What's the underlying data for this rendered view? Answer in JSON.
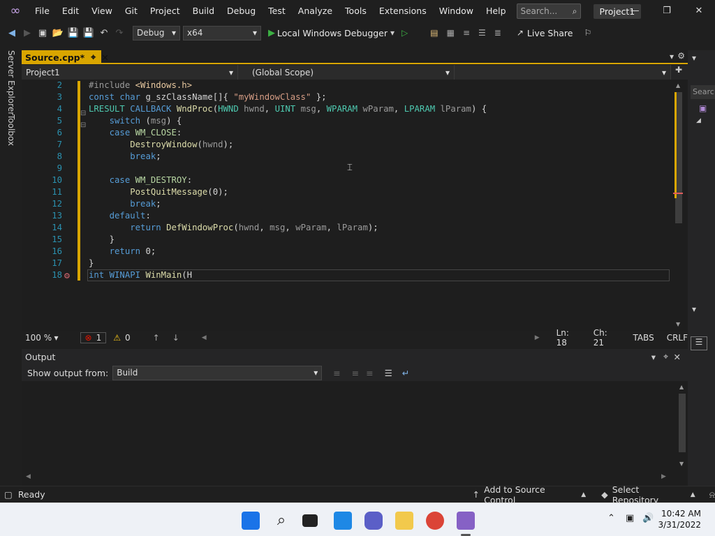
{
  "menu": [
    "File",
    "Edit",
    "View",
    "Git",
    "Project",
    "Build",
    "Debug",
    "Test",
    "Analyze",
    "Tools",
    "Extensions",
    "Window",
    "Help"
  ],
  "search_placeholder": "Search...",
  "project_badge": "Project1",
  "toolbar": {
    "config": "Debug",
    "platform": "x64",
    "debugger": "Local Windows Debugger",
    "live_share": "Live Share"
  },
  "left_tabs": [
    "Server Explorer",
    "Toolbox"
  ],
  "doc_tab": "Source.cpp*",
  "nav": {
    "project": "Project1",
    "scope": "(Global Scope)",
    "member": ""
  },
  "line_numbers": [
    "2",
    "3",
    "4",
    "5",
    "6",
    "7",
    "8",
    "9",
    "10",
    "11",
    "12",
    "13",
    "14",
    "15",
    "16",
    "17",
    "18"
  ],
  "code_lines": [
    [
      [
        "p",
        "#include "
      ],
      [
        "incf",
        "<Windows.h>"
      ]
    ],
    [
      [
        "k",
        "const "
      ],
      [
        "k",
        "char "
      ],
      [
        "d",
        "g_szClassName[]{ "
      ],
      [
        "s",
        "\"myWindowClass\""
      ],
      [
        "d",
        " };"
      ]
    ],
    [
      [
        "t",
        "LRESULT "
      ],
      [
        "k",
        "CALLBACK "
      ],
      [
        "f",
        "WndProc"
      ],
      [
        "d",
        "("
      ],
      [
        "t",
        "HWND "
      ],
      [
        "p",
        "hwnd"
      ],
      [
        "d",
        ", "
      ],
      [
        "t",
        "UINT "
      ],
      [
        "p",
        "msg"
      ],
      [
        "d",
        ", "
      ],
      [
        "t",
        "WPARAM "
      ],
      [
        "p",
        "wParam"
      ],
      [
        "d",
        ", "
      ],
      [
        "t",
        "LPARAM "
      ],
      [
        "p",
        "lParam"
      ],
      [
        "d",
        ") {"
      ]
    ],
    [
      [
        "d",
        "    "
      ],
      [
        "k",
        "switch "
      ],
      [
        "d",
        "("
      ],
      [
        "p",
        "msg"
      ],
      [
        "d",
        ") {"
      ]
    ],
    [
      [
        "d",
        "    "
      ],
      [
        "k",
        "case "
      ],
      [
        "m",
        "WM_CLOSE"
      ],
      [
        "d",
        ":"
      ]
    ],
    [
      [
        "d",
        "        "
      ],
      [
        "f",
        "DestroyWindow"
      ],
      [
        "d",
        "("
      ],
      [
        "p",
        "hwnd"
      ],
      [
        "d",
        ");"
      ]
    ],
    [
      [
        "d",
        "        "
      ],
      [
        "k",
        "break"
      ],
      [
        "d",
        ";"
      ]
    ],
    [
      [
        "d",
        ""
      ]
    ],
    [
      [
        "d",
        "    "
      ],
      [
        "k",
        "case "
      ],
      [
        "m",
        "WM_DESTROY"
      ],
      [
        "d",
        ":"
      ]
    ],
    [
      [
        "d",
        "        "
      ],
      [
        "f",
        "PostQuitMessage"
      ],
      [
        "d",
        "(0);"
      ]
    ],
    [
      [
        "d",
        "        "
      ],
      [
        "k",
        "break"
      ],
      [
        "d",
        ";"
      ]
    ],
    [
      [
        "d",
        "    "
      ],
      [
        "k",
        "default"
      ],
      [
        "d",
        ":"
      ]
    ],
    [
      [
        "d",
        "        "
      ],
      [
        "k",
        "return "
      ],
      [
        "f",
        "DefWindowProc"
      ],
      [
        "d",
        "("
      ],
      [
        "p",
        "hwnd"
      ],
      [
        "d",
        ", "
      ],
      [
        "p",
        "msg"
      ],
      [
        "d",
        ", "
      ],
      [
        "p",
        "wParam"
      ],
      [
        "d",
        ", "
      ],
      [
        "p",
        "lParam"
      ],
      [
        "d",
        ");"
      ]
    ],
    [
      [
        "d",
        "    }"
      ]
    ],
    [
      [
        "d",
        "    "
      ],
      [
        "k",
        "return "
      ],
      [
        "d",
        "0;"
      ]
    ],
    [
      [
        "d",
        "}"
      ]
    ],
    [
      [
        "k",
        "int "
      ],
      [
        "k",
        "WINAPI "
      ],
      [
        "f",
        "WinMain"
      ],
      [
        "d",
        "(H"
      ]
    ]
  ],
  "editor_status": {
    "zoom": "100 %",
    "errors": "1",
    "warnings": "0",
    "line": "Ln: 18",
    "col": "Ch: 21",
    "tabs": "TABS",
    "eol": "CRLF"
  },
  "output": {
    "title": "Output",
    "show_from_label": "Show output from:",
    "source": "Build"
  },
  "statusbar": {
    "ready": "Ready",
    "source_control": "Add to Source Control",
    "repo": "Select Repository"
  },
  "clock": {
    "time": "10:42 AM",
    "date": "3/31/2022"
  }
}
